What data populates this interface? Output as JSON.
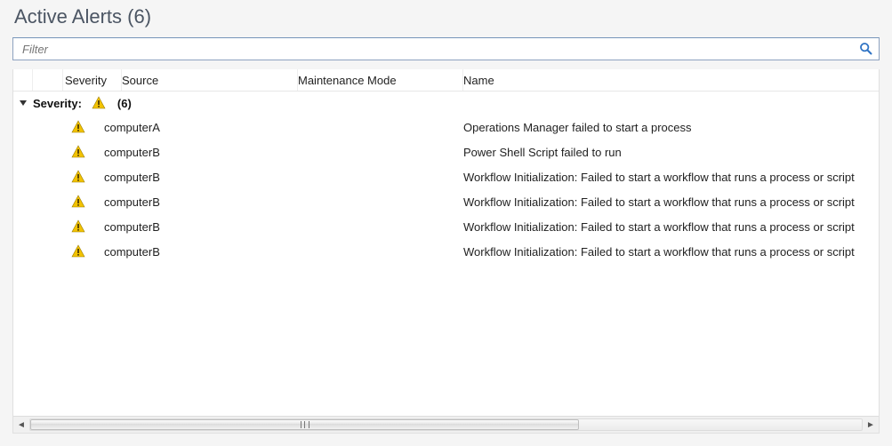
{
  "title": "Active Alerts (6)",
  "filter": {
    "placeholder": "Filter",
    "value": ""
  },
  "columns": {
    "severity": "Severity",
    "source": "Source",
    "maintenance": "Maintenance Mode",
    "name": "Name"
  },
  "group": {
    "label": "Severity:",
    "count": "(6)"
  },
  "rows": [
    {
      "source": "computerA",
      "maintenance": "",
      "name": "Operations Manager failed to start a process"
    },
    {
      "source": "computerB",
      "maintenance": "",
      "name": "Power Shell Script failed to run"
    },
    {
      "source": "computerB",
      "maintenance": "",
      "name": "Workflow Initialization: Failed to start a workflow that runs a process or script"
    },
    {
      "source": "computerB",
      "maintenance": "",
      "name": "Workflow Initialization: Failed to start a workflow that runs a process or script"
    },
    {
      "source": "computerB",
      "maintenance": "",
      "name": "Workflow Initialization: Failed to start a workflow that runs a process or script"
    },
    {
      "source": "computerB",
      "maintenance": "",
      "name": "Workflow Initialization: Failed to start a workflow that runs a process or script"
    }
  ]
}
